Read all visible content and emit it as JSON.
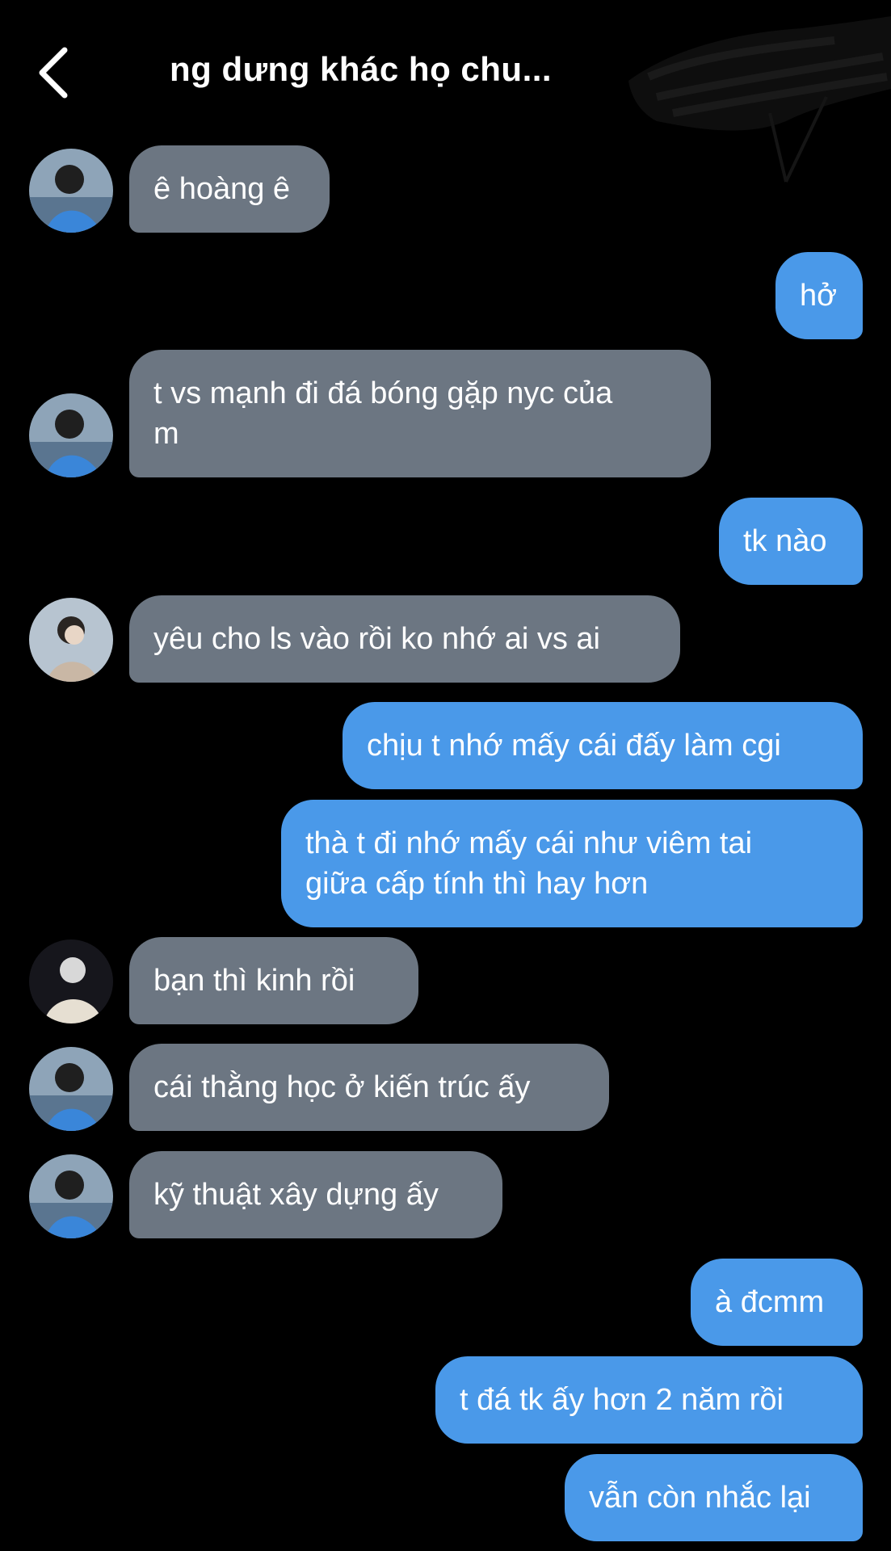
{
  "header": {
    "title": "ng dưng khác họ chu...",
    "back_icon": "chevron-left-icon"
  },
  "colors": {
    "background": "#000000",
    "incoming_bubble": "#6c7682",
    "outgoing_bubble": "#4a99e9",
    "text": "#ffffff"
  },
  "messages": [
    {
      "side": "in",
      "text": "ê hoàng ê"
    },
    {
      "side": "out",
      "text": "hở"
    },
    {
      "side": "in",
      "text": "t vs mạnh đi đá bóng gặp nyc của\nm"
    },
    {
      "side": "out",
      "text": "tk nào"
    },
    {
      "side": "in",
      "text": "yêu cho ls vào rồi ko nhớ ai vs ai"
    },
    {
      "side": "out",
      "text": "chịu t nhớ mấy cái đấy làm cgi"
    },
    {
      "side": "out",
      "text": "thà t đi nhớ mấy cái như viêm tai\ngiữa cấp tính thì hay hơn"
    },
    {
      "side": "in",
      "text": "bạn thì kinh rồi"
    },
    {
      "side": "in",
      "text": "cái thằng học ở kiến trúc ấy"
    },
    {
      "side": "in",
      "text": "kỹ thuật xây dựng ấy"
    },
    {
      "side": "out",
      "text": "à đcmm"
    },
    {
      "side": "out",
      "text": "t đá tk ấy hơn 2 năm rồi"
    },
    {
      "side": "out",
      "text": "vẫn còn nhắc lại"
    }
  ]
}
